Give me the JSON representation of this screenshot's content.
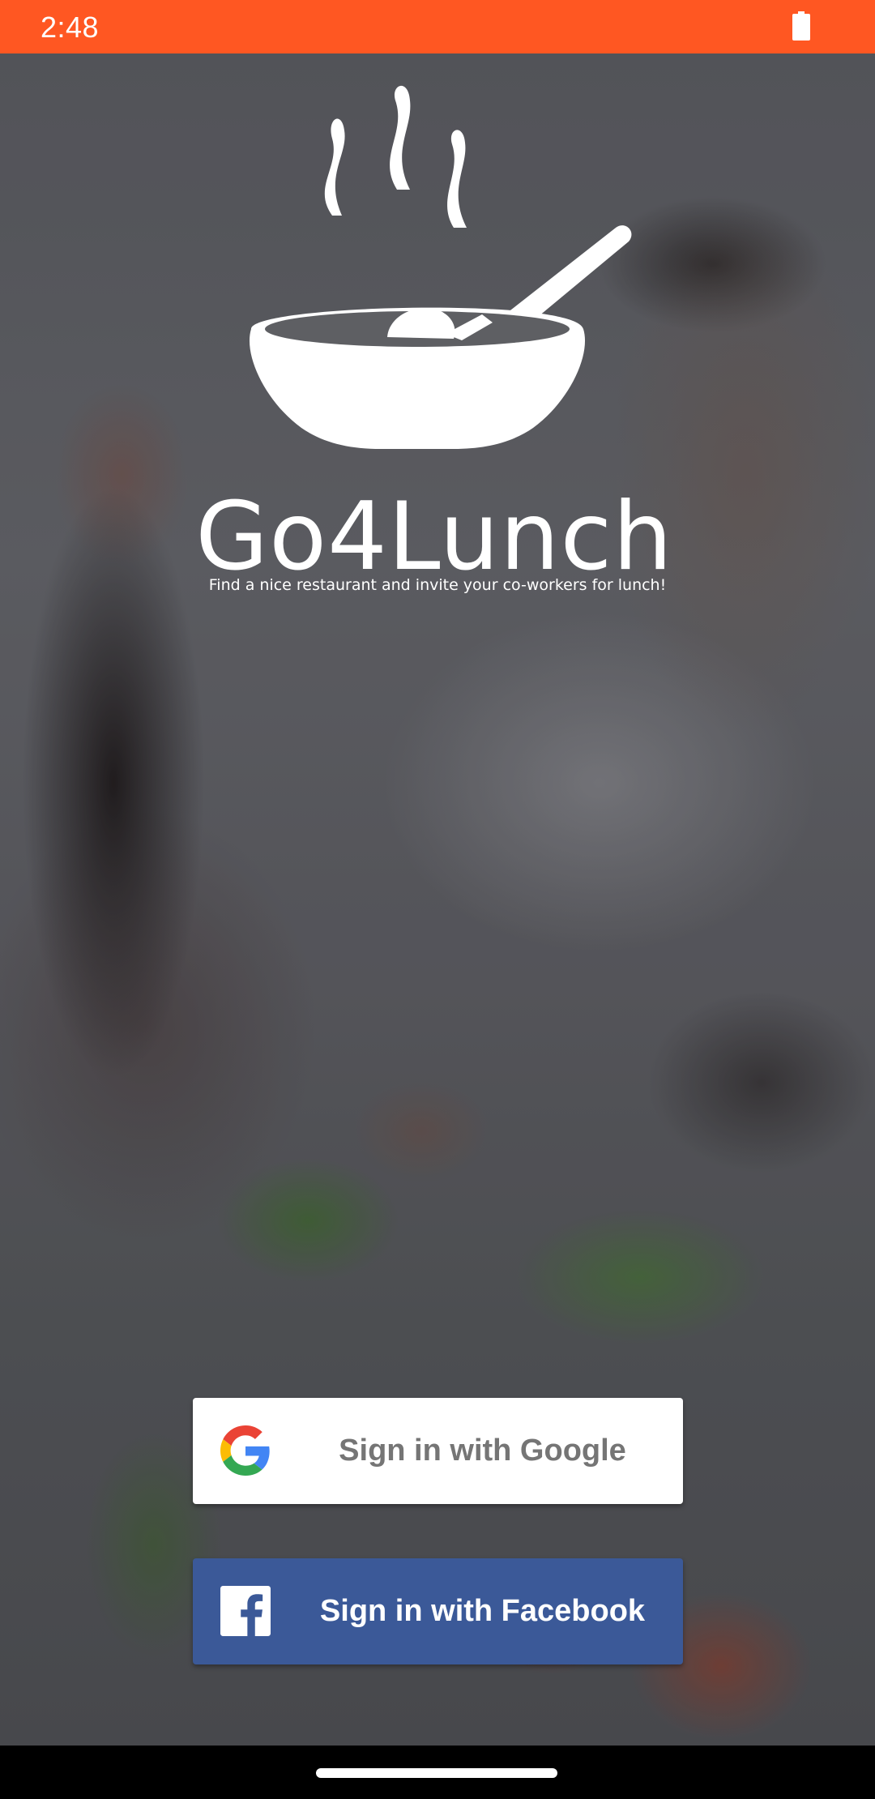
{
  "status_bar": {
    "time": "2:48",
    "background_color": "#FF5722",
    "battery_icon": "battery-full-icon"
  },
  "branding": {
    "logo_icon": "steaming-bowl-icon",
    "app_name": "Go4Lunch",
    "tagline": "Find a nice restaurant and invite your co-workers for lunch!"
  },
  "auth": {
    "google": {
      "label": "Sign in with Google",
      "icon": "google-g-icon",
      "background_color": "#FFFFFF"
    },
    "facebook": {
      "label": "Sign in with Facebook",
      "icon": "facebook-f-icon",
      "background_color": "#3B5998"
    }
  },
  "navigation": {
    "home_handle": "home-gesture-handle"
  }
}
